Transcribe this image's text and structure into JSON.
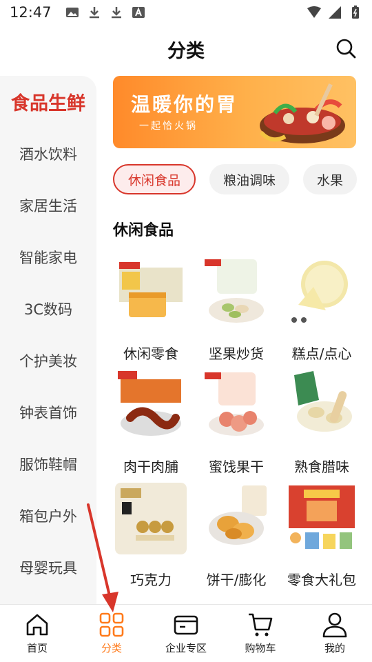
{
  "status_bar": {
    "time": "12:47"
  },
  "header": {
    "title": "分类"
  },
  "sidebar": {
    "items": [
      {
        "label": "食品生鲜",
        "active": true
      },
      {
        "label": "酒水饮料"
      },
      {
        "label": "家居生活"
      },
      {
        "label": "智能家电"
      },
      {
        "label": "3C数码"
      },
      {
        "label": "个护美妆"
      },
      {
        "label": "钟表首饰"
      },
      {
        "label": "服饰鞋帽"
      },
      {
        "label": "箱包户外"
      },
      {
        "label": "母婴玩具"
      }
    ]
  },
  "banner": {
    "title": "温暖你的胃",
    "subtitle": "一起恰火锅"
  },
  "chips": [
    {
      "label": "休闲食品",
      "active": true
    },
    {
      "label": "粮油调味"
    },
    {
      "label": "水果"
    }
  ],
  "section": {
    "title": "休闲食品",
    "items": [
      {
        "label": "休闲零食"
      },
      {
        "label": "坚果炒货"
      },
      {
        "label": "糕点/点心"
      },
      {
        "label": "肉干肉脯"
      },
      {
        "label": "蜜饯果干"
      },
      {
        "label": "熟食腊味"
      },
      {
        "label": "巧克力"
      },
      {
        "label": "饼干/膨化"
      },
      {
        "label": "零食大礼包"
      }
    ]
  },
  "bottom_nav": [
    {
      "label": "首页",
      "icon": "home-icon"
    },
    {
      "label": "分类",
      "icon": "category-icon",
      "active": true
    },
    {
      "label": "企业专区",
      "icon": "wallet-icon"
    },
    {
      "label": "购物车",
      "icon": "cart-icon"
    },
    {
      "label": "我的",
      "icon": "user-icon"
    }
  ],
  "colors": {
    "accent": "#d8362b",
    "nav_active": "#ff7a1a",
    "banner": "#ff8a2a"
  }
}
